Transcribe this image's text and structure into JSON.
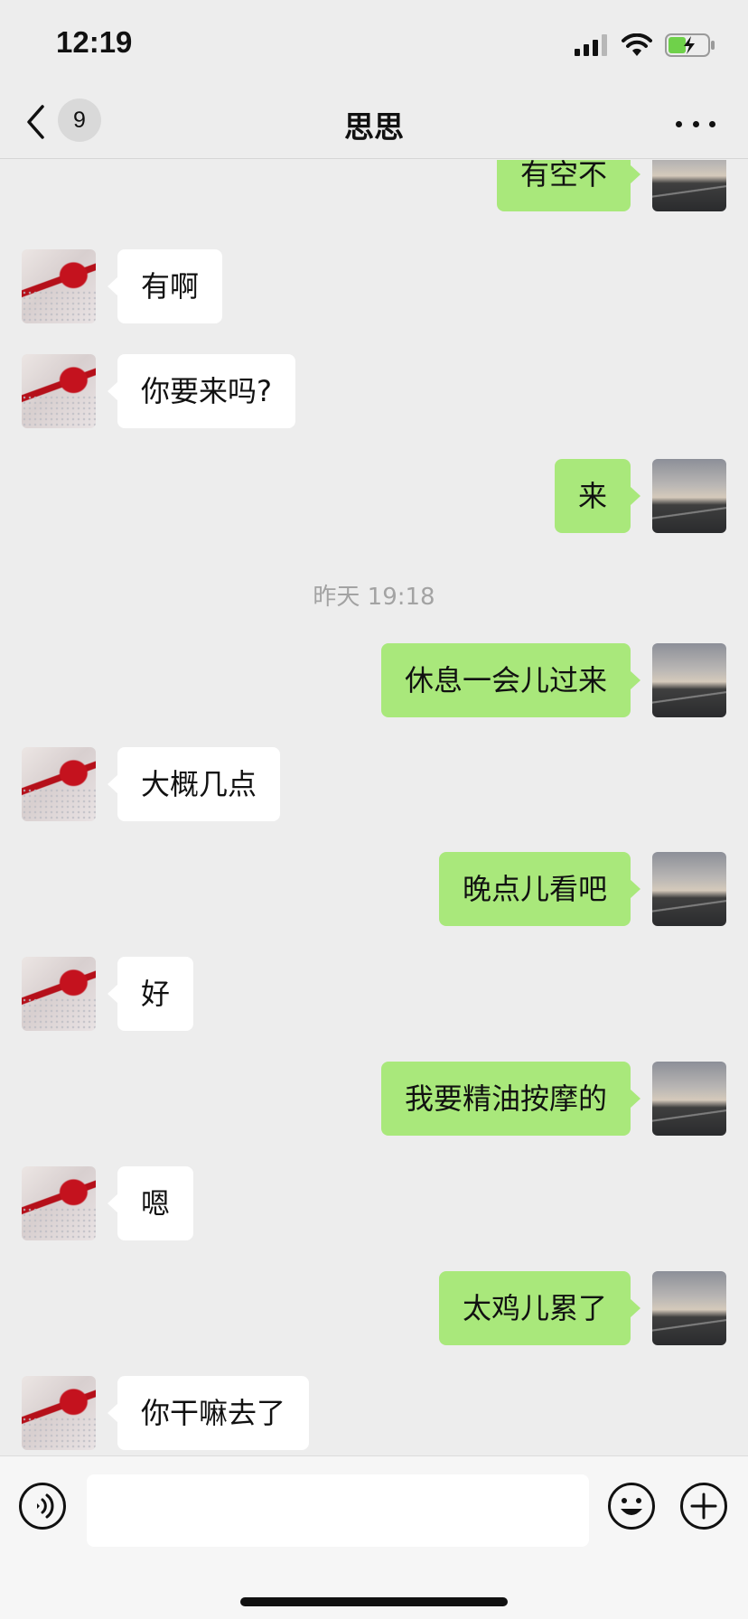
{
  "status_bar": {
    "time": "12:19"
  },
  "nav": {
    "unread_count": "9",
    "title": "思思"
  },
  "messages": [
    {
      "side": "right",
      "text": "有空不"
    },
    {
      "side": "left",
      "text": "有啊"
    },
    {
      "side": "left",
      "text": "你要来吗?"
    },
    {
      "side": "right",
      "text": "来"
    },
    {
      "timestamp": "昨天 19:18"
    },
    {
      "side": "right",
      "text": "休息一会儿过来"
    },
    {
      "side": "left",
      "text": "大概几点"
    },
    {
      "side": "right",
      "text": "晚点儿看吧"
    },
    {
      "side": "left",
      "text": "好"
    },
    {
      "side": "right",
      "text": "我要精油按摩的"
    },
    {
      "side": "left",
      "text": "嗯"
    },
    {
      "side": "right",
      "text": "太鸡儿累了"
    },
    {
      "side": "left",
      "text": "你干嘛去了"
    }
  ],
  "input": {
    "value": "",
    "placeholder": ""
  },
  "colors": {
    "background": "#ededed",
    "sent_bubble": "#a9e87b",
    "received_bubble": "#ffffff",
    "battery": "#6fd14a"
  },
  "icons": [
    "back-arrow-icon",
    "more-icon",
    "signal-icon",
    "wifi-icon",
    "battery-icon",
    "voice-icon",
    "emoji-icon",
    "plus-icon"
  ]
}
